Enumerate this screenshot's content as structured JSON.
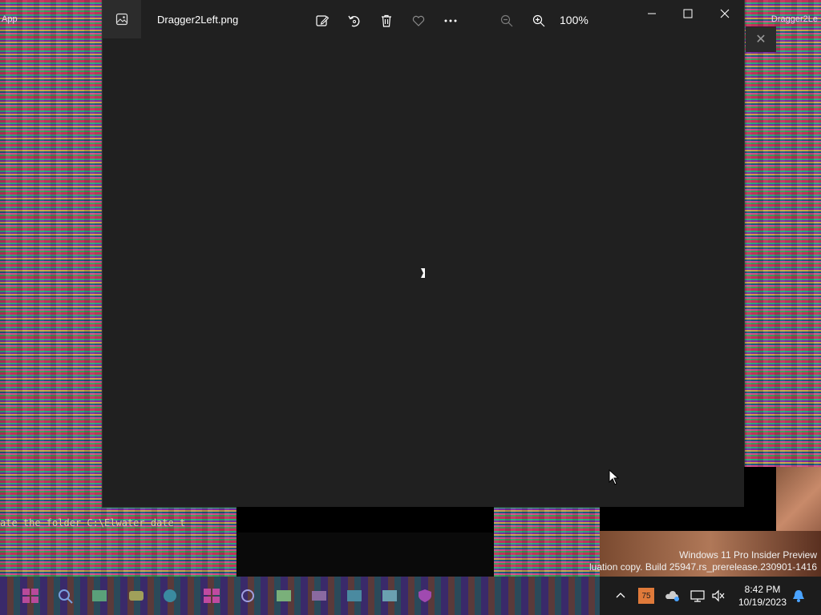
{
  "desktop": {
    "top_left_text": "App",
    "top_right_text": "Dragger2Le",
    "console_text": "ate the folder C:\\Elwater date t"
  },
  "photos": {
    "file_name": "Dragger2Left.png",
    "zoom_level": "100%",
    "toolbar_icons": [
      "edit-icon",
      "rotate-icon",
      "delete-icon",
      "favorite-icon",
      "more-icon",
      "zoom-out-icon",
      "zoom-in-icon"
    ]
  },
  "watermark": {
    "line1": "Windows 11 Pro Insider Preview",
    "line2": "luation copy. Build 25947.rs_prerelease.230901-1416"
  },
  "tray": {
    "weather": "75",
    "time": "8:42 PM",
    "date": "10/19/2023"
  },
  "colors": {
    "window_bg": "#202020",
    "accent_bell": "#4aa3ff"
  }
}
